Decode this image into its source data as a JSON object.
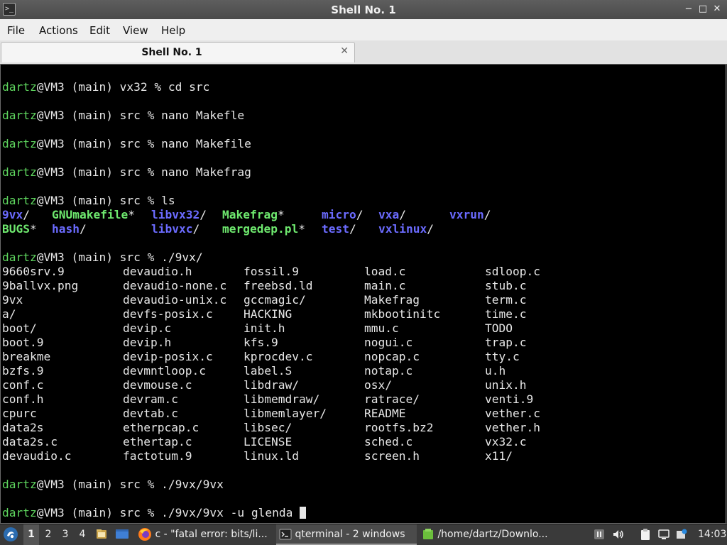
{
  "window": {
    "title": "Shell No. 1",
    "icon": "terminal-icon",
    "controls": {
      "minimize": "−",
      "maximize": "□",
      "close": "✕"
    }
  },
  "menubar": {
    "items": [
      "File",
      "Actions",
      "Edit",
      "View",
      "Help"
    ]
  },
  "tabs": [
    {
      "label": "Shell No. 1",
      "close": "✕"
    }
  ],
  "terminal": {
    "prompt_user": "dartz",
    "lines": [
      {
        "user": "dartz",
        "rest": "@VM3 (main) vx32 % cd src"
      },
      {
        "user": "dartz",
        "rest": "@VM3 (main) src % nano Makefle"
      },
      {
        "user": "dartz",
        "rest": "@VM3 (main) src % nano Makefile"
      },
      {
        "user": "dartz",
        "rest": "@VM3 (main) src % nano Makefrag"
      },
      {
        "user": "dartz",
        "rest": "@VM3 (main) src % ls"
      },
      {
        "user": "dartz",
        "rest": "@VM3 (main) src % ./9vx/"
      },
      {
        "user": "dartz",
        "rest": "@VM3 (main) src % ./9vx/9vx"
      },
      {
        "user": "dartz",
        "rest": "@VM3 (main) src % ./9vx/9vx -u glenda "
      }
    ],
    "ls_rows": [
      [
        {
          "name": "9vx",
          "kind": "dir",
          "suffix": "/"
        },
        {
          "name": "GNUmakefile",
          "kind": "exe",
          "suffix": "*"
        },
        {
          "name": "libvx32",
          "kind": "dir",
          "suffix": "/"
        },
        {
          "name": "Makefrag",
          "kind": "exe",
          "suffix": "*"
        },
        {
          "name": "micro",
          "kind": "dir",
          "suffix": "/"
        },
        {
          "name": "vxa",
          "kind": "dir",
          "suffix": "/"
        },
        {
          "name": "vxrun",
          "kind": "dir",
          "suffix": "/"
        }
      ],
      [
        {
          "name": "BUGS",
          "kind": "exe",
          "suffix": "*"
        },
        {
          "name": "hash",
          "kind": "dir",
          "suffix": "/"
        },
        {
          "name": "libvxc",
          "kind": "dir",
          "suffix": "/"
        },
        {
          "name": "mergedep.pl",
          "kind": "exe",
          "suffix": "*"
        },
        {
          "name": "test",
          "kind": "dir",
          "suffix": "/"
        },
        {
          "name": "vxlinux",
          "kind": "dir",
          "suffix": "/"
        }
      ]
    ],
    "listing_rows": [
      [
        "9660srv.9",
        "devaudio.h",
        "fossil.9",
        "load.c",
        "sdloop.c"
      ],
      [
        "9ballvx.png",
        "devaudio-none.c",
        "freebsd.ld",
        "main.c",
        "stub.c"
      ],
      [
        "9vx",
        "devaudio-unix.c",
        "gccmagic/",
        "Makefrag",
        "term.c"
      ],
      [
        "a/",
        "devfs-posix.c",
        "HACKING",
        "mkbootinitc",
        "time.c"
      ],
      [
        "boot/",
        "devip.c",
        "init.h",
        "mmu.c",
        "TODO"
      ],
      [
        "boot.9",
        "devip.h",
        "kfs.9",
        "nogui.c",
        "trap.c"
      ],
      [
        "breakme",
        "devip-posix.c",
        "kprocdev.c",
        "nopcap.c",
        "tty.c"
      ],
      [
        "bzfs.9",
        "devmntloop.c",
        "label.S",
        "notap.c",
        "u.h"
      ],
      [
        "conf.c",
        "devmouse.c",
        "libdraw/",
        "osx/",
        "unix.h"
      ],
      [
        "conf.h",
        "devram.c",
        "libmemdraw/",
        "ratrace/",
        "venti.9"
      ],
      [
        "cpurc",
        "devtab.c",
        "libmemlayer/",
        "README",
        "vether.c"
      ],
      [
        "data2s",
        "etherpcap.c",
        "libsec/",
        "rootfs.bz2",
        "vether.h"
      ],
      [
        "data2s.c",
        "ethertap.c",
        "LICENSE",
        "sched.c",
        "vx32.c"
      ],
      [
        "devaudio.c",
        "factotum.9",
        "linux.ld",
        "screen.h",
        "x11/"
      ]
    ]
  },
  "taskbar": {
    "start_icon": "start-menu-icon",
    "workspaces": [
      "1",
      "2",
      "3",
      "4"
    ],
    "active_workspace": "1",
    "quicklaunch": [
      "file-manager-icon",
      "show-desktop-icon"
    ],
    "tasks": [
      {
        "icon": "firefox-icon",
        "label": "c - \"fatal error: bits/li..."
      },
      {
        "icon": "terminal-icon",
        "label": "qterminal - 2 windows"
      },
      {
        "icon": "folder-icon",
        "label": "/home/dartz/Downlo..."
      }
    ],
    "tray": [
      "pause-icon",
      "volume-icon",
      "clipboard-icon",
      "network-icon",
      "update-icon"
    ],
    "clock": "14:03"
  },
  "colors": {
    "terminal_bg": "#000000",
    "terminal_fg": "#e6e6e6",
    "prompt_user": "#5fd75f",
    "directory": "#6b6bff",
    "executable": "#6ee86e"
  }
}
